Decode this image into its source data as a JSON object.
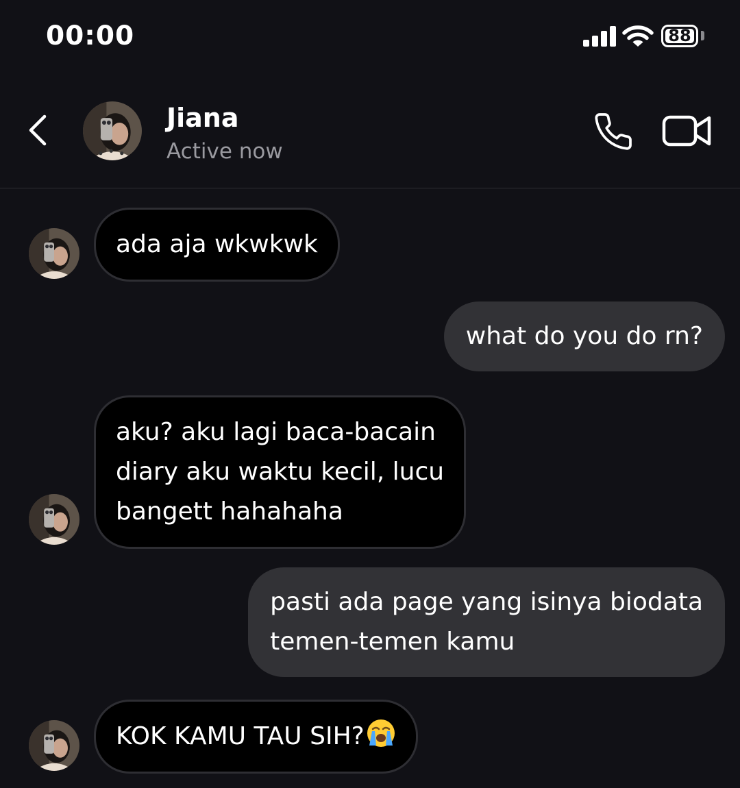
{
  "status_bar": {
    "time": "00:00",
    "battery_level": "88",
    "icons": [
      "cellular-signal-icon",
      "wifi-icon",
      "battery-icon"
    ]
  },
  "header": {
    "back_icon": "chevron-left-icon",
    "contact_name": "Jiana",
    "contact_status": "Active now",
    "call_icon": "phone-icon",
    "video_icon": "video-camera-icon"
  },
  "colors": {
    "background": "#111116",
    "incoming_bubble": "#000000",
    "incoming_border": "#2e2e33",
    "outgoing_bubble": "#323236",
    "secondary_text": "#9a9aa0"
  },
  "messages": [
    {
      "sender": "contact",
      "text": "ada aja wkwkwk"
    },
    {
      "sender": "me",
      "text": "what do you do rn?"
    },
    {
      "sender": "contact",
      "text": "aku? aku lagi baca-bacain\ndiary aku waktu kecil, lucu\nbangett hahahaha"
    },
    {
      "sender": "me",
      "text": "pasti ada page yang isinya biodata\ntemen-temen kamu"
    },
    {
      "sender": "contact",
      "text": "KOK KAMU TAU SIH?",
      "emoji": "loudly-crying-face-icon"
    }
  ]
}
